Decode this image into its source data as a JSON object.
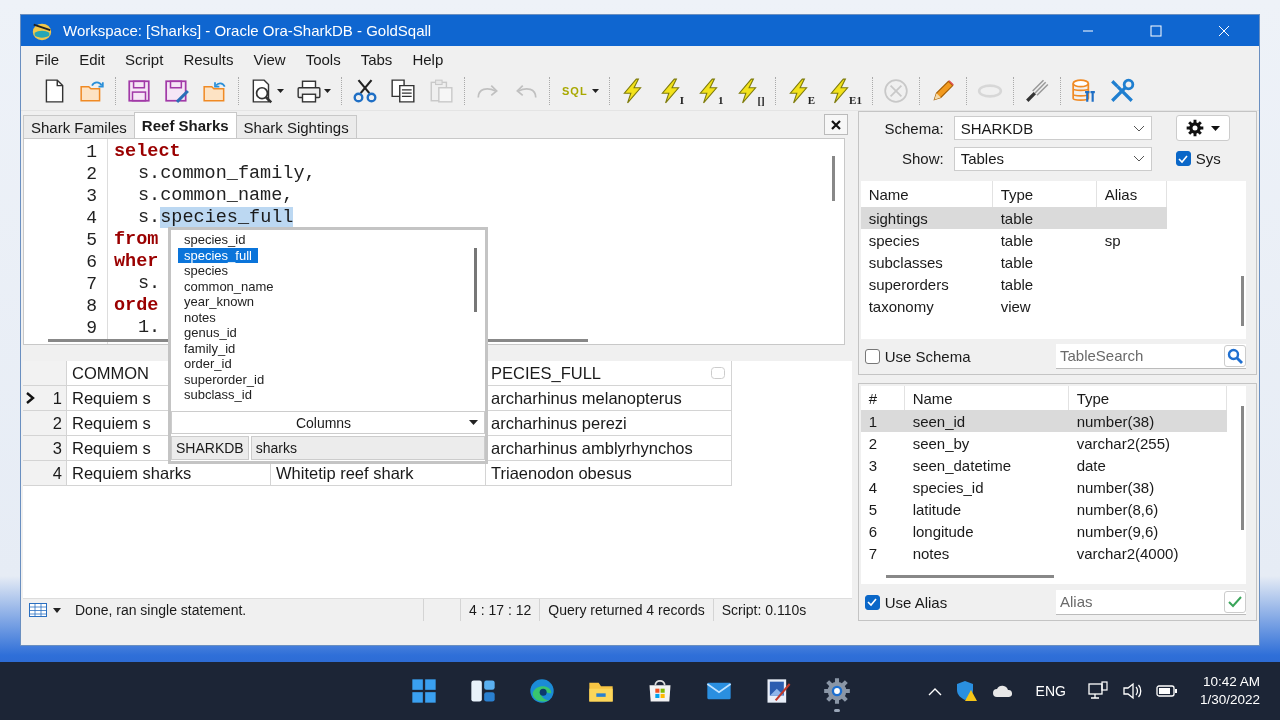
{
  "window": {
    "title": "Workspace: [Sharks] - Oracle Ora-SharkDB - GoldSqall"
  },
  "menu": [
    "File",
    "Edit",
    "Script",
    "Results",
    "View",
    "Tools",
    "Tabs",
    "Help"
  ],
  "toolbar": [
    {
      "kind": "button",
      "disabled": false
    },
    {
      "kind": "button",
      "disabled": false
    },
    {
      "kind": "separator"
    },
    {
      "kind": "button",
      "disabled": false
    },
    {
      "kind": "button",
      "disabled": false
    },
    {
      "kind": "button",
      "disabled": false
    },
    {
      "kind": "separator"
    },
    {
      "kind": "button",
      "disabled": false,
      "dropdown": true
    },
    {
      "kind": "button",
      "disabled": false,
      "dropdown": true
    },
    {
      "kind": "separator"
    },
    {
      "kind": "button",
      "disabled": false
    },
    {
      "kind": "button",
      "disabled": false
    },
    {
      "kind": "button",
      "disabled": true
    },
    {
      "kind": "separator"
    },
    {
      "kind": "button",
      "disabled": true
    },
    {
      "kind": "button",
      "disabled": true
    },
    {
      "kind": "separator"
    },
    {
      "kind": "button",
      "disabled": false,
      "dropdown": true,
      "badge": "SQL"
    },
    {
      "kind": "separator"
    },
    {
      "kind": "button",
      "disabled": false
    },
    {
      "kind": "button",
      "disabled": false,
      "badge": "I"
    },
    {
      "kind": "button",
      "disabled": false,
      "badge": "1"
    },
    {
      "kind": "button",
      "disabled": false,
      "badge": "[]"
    },
    {
      "kind": "separator"
    },
    {
      "kind": "button",
      "disabled": false,
      "badge": "E"
    },
    {
      "kind": "button",
      "disabled": false,
      "badge": "E1"
    },
    {
      "kind": "separator"
    },
    {
      "kind": "button",
      "disabled": true
    },
    {
      "kind": "separator"
    },
    {
      "kind": "button",
      "disabled": false
    },
    {
      "kind": "separator"
    },
    {
      "kind": "button",
      "disabled": true
    },
    {
      "kind": "separator"
    },
    {
      "kind": "button",
      "disabled": false
    },
    {
      "kind": "separator"
    },
    {
      "kind": "button",
      "disabled": false
    },
    {
      "kind": "button",
      "disabled": false
    }
  ],
  "editor_tabs": [
    {
      "label": "Shark Familes",
      "selected": false
    },
    {
      "label": "Reef Sharks",
      "selected": true
    },
    {
      "label": "Shark Sightings",
      "selected": false
    }
  ],
  "editor": {
    "lines": [
      {
        "number": "1",
        "indent": false,
        "tokens": [
          {
            "text": "select",
            "kind": "keyword"
          }
        ]
      },
      {
        "number": "2",
        "indent": true,
        "tokens": [
          {
            "text": "s.common_family,",
            "kind": "plain"
          }
        ]
      },
      {
        "number": "3",
        "indent": true,
        "tokens": [
          {
            "text": "s.common_name,",
            "kind": "plain"
          }
        ]
      },
      {
        "number": "4",
        "indent": true,
        "tokens": [
          {
            "text": "s.",
            "kind": "plain"
          },
          {
            "text": "species_full",
            "kind": "selection"
          }
        ]
      },
      {
        "number": "5",
        "indent": false,
        "tokens": [
          {
            "text": "from",
            "kind": "keyword"
          }
        ]
      },
      {
        "number": "6",
        "indent": false,
        "tokens": [
          {
            "text": "wher",
            "kind": "keyword"
          }
        ]
      },
      {
        "number": "7",
        "indent": true,
        "tokens": [
          {
            "text": "s.",
            "kind": "plain"
          }
        ]
      },
      {
        "number": "8",
        "indent": false,
        "tokens": [
          {
            "text": "orde",
            "kind": "keyword"
          }
        ]
      },
      {
        "number": "9",
        "indent": true,
        "tokens": [
          {
            "text": "1.",
            "kind": "plain"
          }
        ]
      }
    ]
  },
  "autocomplete": {
    "items": [
      {
        "label": "species_id",
        "selected": false
      },
      {
        "label": "species_full",
        "selected": true
      },
      {
        "label": "species",
        "selected": false
      },
      {
        "label": "common_name",
        "selected": false
      },
      {
        "label": "year_known",
        "selected": false
      },
      {
        "label": "notes",
        "selected": false
      },
      {
        "label": "genus_id",
        "selected": false
      },
      {
        "label": "family_id",
        "selected": false
      },
      {
        "label": "order_id",
        "selected": false
      },
      {
        "label": "superorder_id",
        "selected": false
      },
      {
        "label": "subclass_id",
        "selected": false
      }
    ],
    "source": "Columns",
    "schema": "SHARKDB",
    "table": "sharks"
  },
  "results": {
    "columns": {
      "column_1": "COMMON",
      "column_3": "PECIES_FULL"
    },
    "rows": [
      {
        "number": "1",
        "current": true,
        "column_1": "Requiem s",
        "column_3": "archarhinus melanopterus"
      },
      {
        "number": "2",
        "current": false,
        "column_1": "Requiem s",
        "column_3": "archarhinus perezi"
      },
      {
        "number": "3",
        "current": false,
        "column_1": "Requiem s",
        "column_3": "archarhinus amblyrhynchos"
      },
      {
        "number": "4",
        "current": false,
        "column_1": "Requiem sharks",
        "column_2": "Whitetip reef shark",
        "column_3": "Triaenodon obesus"
      }
    ]
  },
  "status_bar": {
    "message": "Done, ran single statement.",
    "position": "4 : 17 : 12",
    "records": "Query returned 4 records",
    "timing": "Script: 0.110s"
  },
  "schema_browser": {
    "schema_label": "Schema:",
    "schema": "SHARKDB",
    "show_label": "Show:",
    "show": "Tables",
    "sys": {
      "label": "Sys",
      "checked": true
    },
    "object_columns": [
      "Name",
      "Type",
      "Alias"
    ],
    "objects": [
      {
        "name": "sightings",
        "type": "table",
        "selected": true
      },
      {
        "name": "species",
        "type": "table",
        "alias": "sp",
        "selected": false
      },
      {
        "name": "subclasses",
        "type": "table",
        "selected": false
      },
      {
        "name": "superorders",
        "type": "table",
        "selected": false
      },
      {
        "name": "taxonomy",
        "type": "view",
        "selected": false
      }
    ],
    "use_schema": {
      "label": "Use Schema",
      "checked": false
    },
    "table_search": {
      "placeholder": "TableSearch"
    },
    "field_columns": [
      "#",
      "Name",
      "Type"
    ],
    "fields": [
      {
        "number": "1",
        "name": "seen_id",
        "type": "number(38)",
        "selected": true
      },
      {
        "number": "2",
        "name": "seen_by",
        "type": "varchar2(255)",
        "selected": false
      },
      {
        "number": "3",
        "name": "seen_datetime",
        "type": "date",
        "selected": false
      },
      {
        "number": "4",
        "name": "species_id",
        "type": "number(38)",
        "selected": false
      },
      {
        "number": "5",
        "name": "latitude",
        "type": "number(8,6)",
        "selected": false
      },
      {
        "number": "6",
        "name": "longitude",
        "type": "number(9,6)",
        "selected": false
      },
      {
        "number": "7",
        "name": "notes",
        "type": "varchar2(4000)",
        "selected": false
      }
    ],
    "use_alias": {
      "label": "Use Alias",
      "checked": true
    },
    "alias": {
      "placeholder": "Alias"
    }
  },
  "taskbar": {
    "apps": [
      {
        "running": false
      },
      {
        "running": false
      },
      {
        "running": false
      },
      {
        "running": false
      },
      {
        "running": false
      },
      {
        "running": false
      },
      {
        "running": false
      },
      {
        "running": true
      }
    ],
    "language": "ENG",
    "time": "10:42 AM",
    "date": "1/30/2022"
  }
}
